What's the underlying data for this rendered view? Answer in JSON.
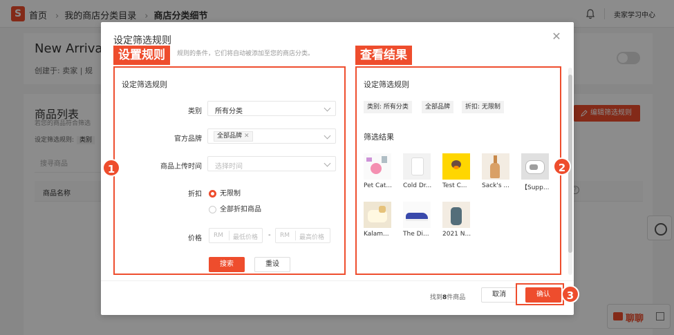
{
  "topbar": {
    "logo_text": "S",
    "breadcrumbs": [
      "首页",
      "我的商店分类目录",
      "商店分类细节"
    ],
    "user_label": "卖家学习中心",
    "icons": [
      "shopee-logo-icon",
      "bell-icon"
    ]
  },
  "category_card": {
    "title": "New Arrivals",
    "created_by": "创建于:  卖家 | 规"
  },
  "product_list": {
    "title": "商品列表",
    "desc": "若您的商品符合筛选",
    "rule_label": "设定筛选规则:",
    "rule_chip": "类别",
    "search_placeholder": "搜寻商品",
    "col_name": "商品名称",
    "edit_rule_button": "编辑筛选规则"
  },
  "chat": {
    "label": "聊聊"
  },
  "modal": {
    "title": "设定筛选规则",
    "desc": "规则的条件，它们将自动被添加至您的商店分类。",
    "annotations": {
      "left_label": "设置规则",
      "right_label": "查看结果",
      "badges": [
        "1",
        "2",
        "3"
      ]
    },
    "left": {
      "section_title": "设定筛选规则",
      "category_label": "类别",
      "category_value": "所有分类",
      "brand_label": "官方品牌",
      "brand_chip": "全部品牌",
      "upload_time_label": "商品上传时间",
      "upload_time_placeholder": "选择时间",
      "discount_label": "折扣",
      "discount_options": [
        "无限制",
        "全部折扣商品"
      ],
      "discount_selected": "无限制",
      "price_label": "价格",
      "price_prefix": "RM",
      "price_min_placeholder": "最低价格",
      "price_max_placeholder": "最高价格",
      "price_separator": "-",
      "search_button": "搜索",
      "reset_button": "重设"
    },
    "right": {
      "section_title": "设定筛选规则",
      "chips": [
        "类别: 所有分类",
        "全部品牌",
        "折扣: 无限制"
      ],
      "results_title": "筛选结果",
      "products": [
        {
          "name": "Pet Cat..."
        },
        {
          "name": "Cold Dr..."
        },
        {
          "name": "Test C..."
        },
        {
          "name": "Sack's ..."
        },
        {
          "name": "【Supp..."
        },
        {
          "name": "Kalam..."
        },
        {
          "name": "The Di..."
        },
        {
          "name": "2021 N..."
        }
      ]
    },
    "footer": {
      "found_prefix": "找到",
      "found_count": "8",
      "found_suffix": "件商品",
      "cancel_button": "取消",
      "confirm_button": "确认"
    }
  },
  "colors": {
    "accent": "#ee4d2d"
  }
}
